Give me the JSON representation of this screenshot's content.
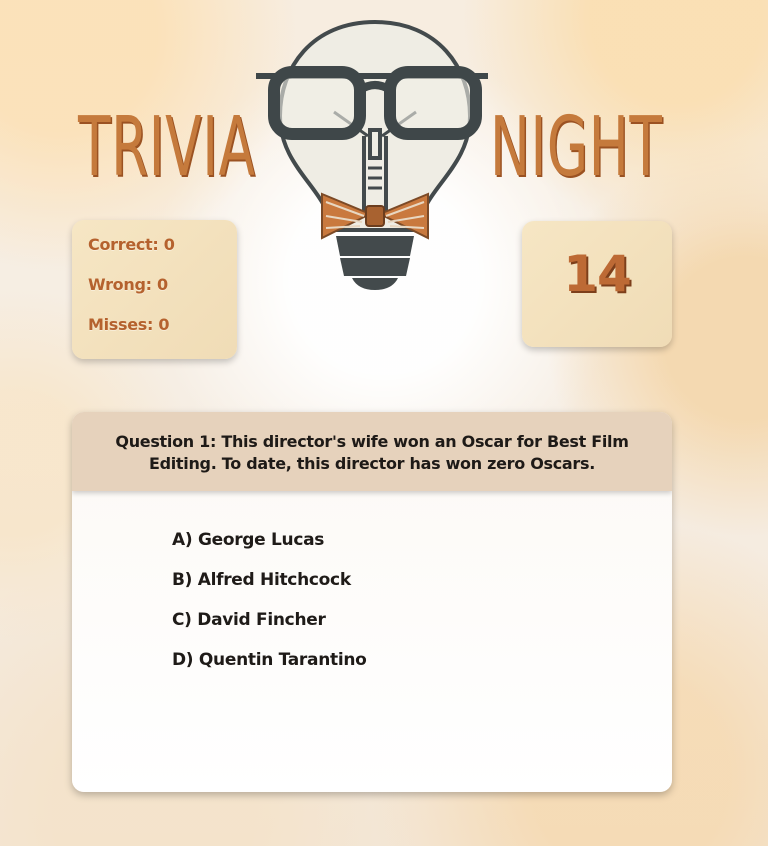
{
  "header": {
    "title_left": "TRIVIA",
    "title_right": "NIGHT",
    "logo_icon": "lightbulb-with-glasses-and-bowtie-icon"
  },
  "stats": {
    "correct": "Correct: 0",
    "wrong": "Wrong: 0",
    "misses": "Misses: 0"
  },
  "timer": {
    "value": "14"
  },
  "question": {
    "text": "Question 1: This director's wife won an Oscar for Best Film Editing. To date, this director has won zero Oscars."
  },
  "answers": [
    "A) George Lucas",
    "B) Alfred Hitchcock",
    "C) David Fincher",
    "D) Quentin Tarantino"
  ],
  "colors": {
    "accent": "#c57a3c",
    "panel": "#f3e1bd",
    "question_bar": "#e6d2bc"
  }
}
